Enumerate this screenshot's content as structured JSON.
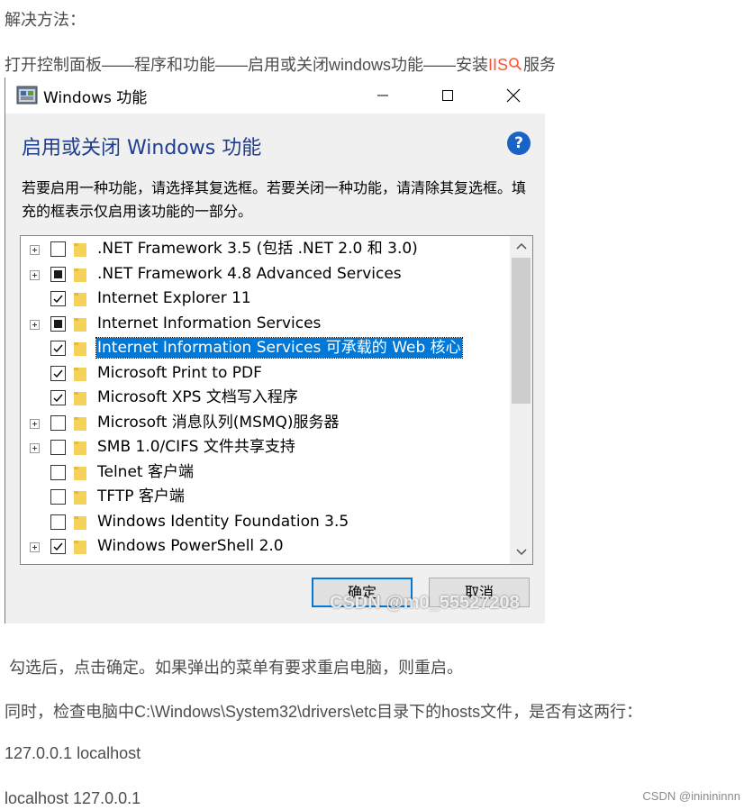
{
  "article": {
    "solution_heading": "解决方法：",
    "path_prefix": "打开控制面板——程序和功能——启用或关闭windows功能——安装",
    "keyword": "IIS",
    "path_suffix": "服务",
    "after_text": "勾选后，点击确定。如果弹出的菜单有要求重启电脑，则重启。",
    "hosts_check": "同时，检查电脑中C:\\Windows\\System32\\drivers\\etc目录下的hosts文件，是否有这两行：",
    "host_line_1": "127.0.0.1 localhost",
    "host_line_2": "localhost 127.0.0.1",
    "site_watermark": "CSDN @ininininnn"
  },
  "dialog": {
    "title": "Windows 功能",
    "heading": "启用或关闭 Windows 功能",
    "help_glyph": "?",
    "description": "若要启用一种功能，请选择其复选框。若要关闭一种功能，请清除其复选框。填充的框表示仅启用该功能的一部分。",
    "features": [
      {
        "label": ".NET Framework 3.5 (包括 .NET 2.0 和 3.0)",
        "state": "unchecked",
        "expandable": true,
        "selected": false
      },
      {
        "label": ".NET Framework 4.8 Advanced Services",
        "state": "partial",
        "expandable": true,
        "selected": false
      },
      {
        "label": "Internet Explorer 11",
        "state": "checked",
        "expandable": false,
        "selected": false
      },
      {
        "label": "Internet Information Services",
        "state": "partial",
        "expandable": true,
        "selected": false
      },
      {
        "label": "Internet Information Services 可承载的 Web 核心",
        "state": "checked",
        "expandable": false,
        "selected": true
      },
      {
        "label": "Microsoft Print to PDF",
        "state": "checked",
        "expandable": false,
        "selected": false
      },
      {
        "label": "Microsoft XPS 文档写入程序",
        "state": "checked",
        "expandable": false,
        "selected": false
      },
      {
        "label": "Microsoft 消息队列(MSMQ)服务器",
        "state": "unchecked",
        "expandable": true,
        "selected": false
      },
      {
        "label": "SMB 1.0/CIFS 文件共享支持",
        "state": "unchecked",
        "expandable": true,
        "selected": false
      },
      {
        "label": "Telnet 客户端",
        "state": "unchecked",
        "expandable": false,
        "selected": false
      },
      {
        "label": "TFTP 客户端",
        "state": "unchecked",
        "expandable": false,
        "selected": false
      },
      {
        "label": "Windows Identity Foundation 3.5",
        "state": "unchecked",
        "expandable": false,
        "selected": false
      },
      {
        "label": "Windows PowerShell 2.0",
        "state": "checked",
        "expandable": true,
        "selected": false
      }
    ],
    "ok_label": "确定",
    "cancel_label": "取消",
    "image_watermark": "CSDN @m0_55527208"
  },
  "colors": {
    "keyword": "#fc5531",
    "heading_blue": "#1e3d8f",
    "selection": "#0078d7",
    "folder": "#f5d25a"
  }
}
